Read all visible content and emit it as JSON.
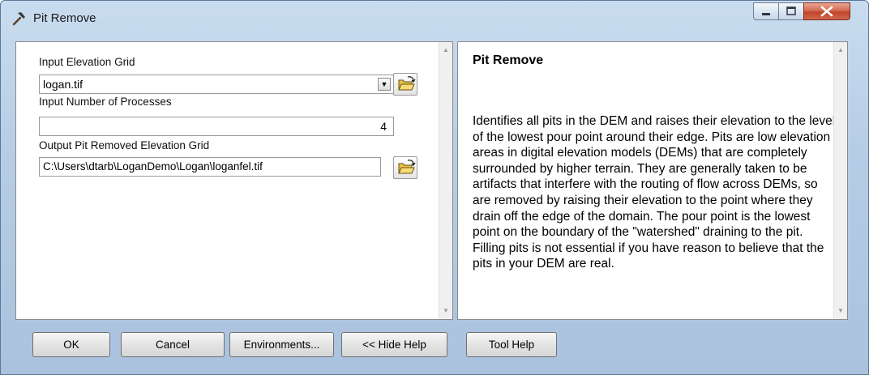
{
  "window": {
    "title": "Pit Remove"
  },
  "form": {
    "input_elevation_label": "Input Elevation Grid",
    "input_elevation_value": "logan.tif",
    "processes_label": "Input Number of Processes",
    "processes_value": "4",
    "output_label": "Output Pit Removed Elevation Grid",
    "output_value": "C:\\Users\\dtarb\\LoganDemo\\Logan\\loganfel.tif"
  },
  "help": {
    "title": "Pit Remove",
    "body": "Identifies all pits in the DEM and raises their elevation to the level of the lowest pour point around their edge. Pits are low elevation areas in digital elevation models (DEMs) that are completely surrounded by higher terrain. They are generally taken to be artifacts that interfere with the routing of flow across DEMs, so are removed by raising their elevation to the point where they drain off the edge of the domain. The pour point is the lowest point on the boundary of the \"watershed\" draining to the pit. Filling pits is not essential if you have reason to believe that the pits in your DEM are real."
  },
  "buttons": {
    "ok": "OK",
    "cancel": "Cancel",
    "environments": "Environments...",
    "hide_help": "<< Hide Help",
    "tool_help": "Tool Help"
  },
  "icons": {
    "title": "hammer-icon",
    "browse": "open-folder-icon",
    "dropdown": "chevron-down-icon"
  }
}
